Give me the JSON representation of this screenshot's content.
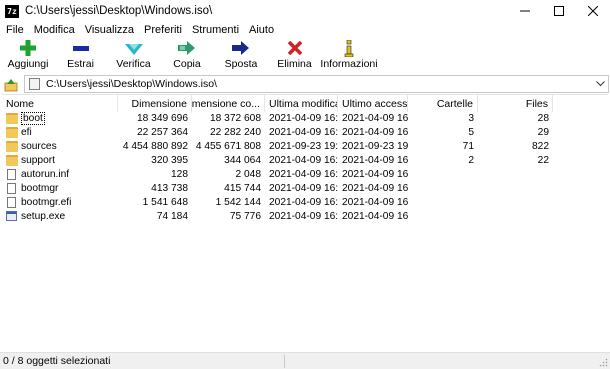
{
  "window": {
    "title": "C:\\Users\\jessi\\Desktop\\Windows.iso\\",
    "app_icon": "7z"
  },
  "menu": [
    "File",
    "Modifica",
    "Visualizza",
    "Preferiti",
    "Strumenti",
    "Aiuto"
  ],
  "toolbar": {
    "add": "Aggiungi",
    "extract": "Estrai",
    "test": "Verifica",
    "copy": "Copia",
    "move": "Sposta",
    "delete": "Elimina",
    "info": "Informazioni"
  },
  "address": {
    "path": "C:\\Users\\jessi\\Desktop\\Windows.iso\\"
  },
  "columns": {
    "name": "Nome",
    "size": "Dimensione",
    "packed": "Dimensione co...",
    "modified": "Ultima modifica",
    "accessed": "Ultimo accesso",
    "folders": "Cartelle",
    "files": "Files"
  },
  "rows": [
    {
      "name": "boot",
      "type": "folder",
      "size": "18 349 696",
      "packed": "18 372 608",
      "modified": "2021-04-09 16:54",
      "accessed": "2021-04-09 16:54",
      "folders": "3",
      "files": "28"
    },
    {
      "name": "efi",
      "type": "folder",
      "size": "22 257 364",
      "packed": "22 282 240",
      "modified": "2021-04-09 16:54",
      "accessed": "2021-04-09 16:54",
      "folders": "5",
      "files": "29"
    },
    {
      "name": "sources",
      "type": "folder",
      "size": "4 454 880 892",
      "packed": "4 455 671 808",
      "modified": "2021-09-23 19:07",
      "accessed": "2021-09-23 19:07",
      "folders": "71",
      "files": "822"
    },
    {
      "name": "support",
      "type": "folder",
      "size": "320 395",
      "packed": "344 064",
      "modified": "2021-04-09 16:54",
      "accessed": "2021-04-09 16:54",
      "folders": "2",
      "files": "22"
    },
    {
      "name": "autorun.inf",
      "type": "file",
      "size": "128",
      "packed": "2 048",
      "modified": "2021-04-09 16:51",
      "accessed": "2021-04-09 16:51",
      "folders": "",
      "files": ""
    },
    {
      "name": "bootmgr",
      "type": "file",
      "size": "413 738",
      "packed": "415 744",
      "modified": "2021-04-09 16:51",
      "accessed": "2021-04-09 16:51",
      "folders": "",
      "files": ""
    },
    {
      "name": "bootmgr.efi",
      "type": "file",
      "size": "1 541 648",
      "packed": "1 542 144",
      "modified": "2021-04-09 16:51",
      "accessed": "2021-04-09 16:51",
      "folders": "",
      "files": ""
    },
    {
      "name": "setup.exe",
      "type": "exe",
      "size": "74 184",
      "packed": "75 776",
      "modified": "2021-04-09 16:51",
      "accessed": "2021-04-09 16:51",
      "folders": "",
      "files": ""
    }
  ],
  "status": {
    "selection": "0 / 8 oggetti selezionati"
  },
  "colors": {
    "add_green": "#1fa12e",
    "extract_blue": "#1a2ca0",
    "test_teal": "#29b6c6",
    "copy_green": "#2e9a72",
    "move_navy": "#1a2a8c",
    "delete_red": "#d52020",
    "info_yellow": "#e1c21c",
    "folder_yellow": "#f3c85b"
  }
}
